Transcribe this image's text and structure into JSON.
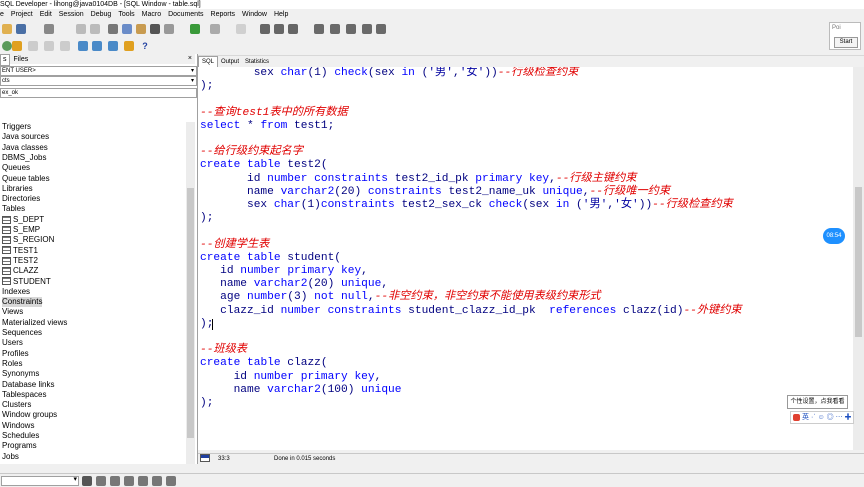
{
  "window": {
    "title": "SQL Developer - lihong@java0104DB - [SQL Window - table.sql]"
  },
  "menu": [
    "e",
    "Project",
    "Edit",
    "Session",
    "Debug",
    "Tools",
    "Macro",
    "Documents",
    "Reports",
    "Window",
    "Help"
  ],
  "floating_widget": {
    "input": "Poi",
    "start_label": "Start"
  },
  "left_panel": {
    "tabs": [
      "s",
      "Files"
    ],
    "user_combo": "ENT USER>",
    "type_combo": "cts",
    "filter_value": "ex_ok",
    "tree_items": [
      {
        "label": "Triggers",
        "icon": "",
        "selected": false
      },
      {
        "label": "Java sources",
        "icon": "",
        "selected": false
      },
      {
        "label": "Java classes",
        "icon": "",
        "selected": false
      },
      {
        "label": "DBMS_Jobs",
        "icon": "",
        "selected": false
      },
      {
        "label": "Queues",
        "icon": "",
        "selected": false
      },
      {
        "label": "Queue tables",
        "icon": "",
        "selected": false
      },
      {
        "label": "Libraries",
        "icon": "",
        "selected": false
      },
      {
        "label": "Directories",
        "icon": "",
        "selected": false
      },
      {
        "label": "Tables",
        "icon": "",
        "selected": false
      },
      {
        "label": "S_DEPT",
        "icon": "table-icon",
        "selected": false
      },
      {
        "label": "S_EMP",
        "icon": "table-icon",
        "selected": false
      },
      {
        "label": "S_REGION",
        "icon": "table-icon",
        "selected": false
      },
      {
        "label": "TEST1",
        "icon": "table-icon",
        "selected": false
      },
      {
        "label": "TEST2",
        "icon": "table-icon",
        "selected": false
      },
      {
        "label": "CLAZZ",
        "icon": "table-icon",
        "selected": false
      },
      {
        "label": "STUDENT",
        "icon": "table-icon",
        "selected": false
      },
      {
        "label": "Indexes",
        "icon": "",
        "selected": false
      },
      {
        "label": "Constraints",
        "icon": "",
        "selected": true
      },
      {
        "label": "Views",
        "icon": "",
        "selected": false
      },
      {
        "label": "Materialized views",
        "icon": "",
        "selected": false
      },
      {
        "label": "Sequences",
        "icon": "",
        "selected": false
      },
      {
        "label": "Users",
        "icon": "",
        "selected": false
      },
      {
        "label": "Profiles",
        "icon": "",
        "selected": false
      },
      {
        "label": "Roles",
        "icon": "",
        "selected": false
      },
      {
        "label": "Synonyms",
        "icon": "",
        "selected": false
      },
      {
        "label": "Database links",
        "icon": "",
        "selected": false
      },
      {
        "label": "Tablespaces",
        "icon": "",
        "selected": false
      },
      {
        "label": "Clusters",
        "icon": "",
        "selected": false
      },
      {
        "label": "Window groups",
        "icon": "",
        "selected": false
      },
      {
        "label": "Windows",
        "icon": "",
        "selected": false
      },
      {
        "label": "Schedules",
        "icon": "",
        "selected": false
      },
      {
        "label": "Programs",
        "icon": "",
        "selected": false
      },
      {
        "label": "Jobs",
        "icon": "",
        "selected": false
      }
    ]
  },
  "editor_tabs": [
    "SQL",
    "Output",
    "Statistics"
  ],
  "code_lines": [
    [
      [
        "pl",
        "        sex "
      ],
      [
        "kw",
        "char"
      ],
      [
        "pl",
        "("
      ],
      [
        "nm",
        "1"
      ],
      [
        "pl",
        ") "
      ],
      [
        "kw",
        "check"
      ],
      [
        "pl",
        "(sex "
      ],
      [
        "kw",
        "in"
      ],
      [
        "pl",
        " ("
      ],
      [
        "str",
        "'男'"
      ],
      [
        "pl",
        ","
      ],
      [
        "str",
        "'女'"
      ],
      [
        "pl",
        "))"
      ],
      [
        "cm",
        "--行级检查约束"
      ]
    ],
    [
      [
        "pl",
        ");"
      ]
    ],
    [
      [
        "pl",
        ""
      ]
    ],
    [
      [
        "cm",
        "--查询test1表中的所有数据"
      ]
    ],
    [
      [
        "kw",
        "select"
      ],
      [
        "pl",
        " * "
      ],
      [
        "kw",
        "from"
      ],
      [
        "pl",
        " test1;"
      ]
    ],
    [
      [
        "pl",
        ""
      ]
    ],
    [
      [
        "cm",
        "--给行级约束起名字"
      ]
    ],
    [
      [
        "kw",
        "create"
      ],
      [
        "pl",
        " "
      ],
      [
        "kw",
        "table"
      ],
      [
        "pl",
        " test2("
      ]
    ],
    [
      [
        "pl",
        "       id "
      ],
      [
        "kw",
        "number"
      ],
      [
        "pl",
        " "
      ],
      [
        "kw",
        "constraints"
      ],
      [
        "pl",
        " test2_id_pk "
      ],
      [
        "kw",
        "primary key"
      ],
      [
        "pl",
        ","
      ],
      [
        "cm",
        "--行级主键约束"
      ]
    ],
    [
      [
        "pl",
        "       name "
      ],
      [
        "kw",
        "varchar2"
      ],
      [
        "pl",
        "("
      ],
      [
        "nm",
        "20"
      ],
      [
        "pl",
        ") "
      ],
      [
        "kw",
        "constraints"
      ],
      [
        "pl",
        " test2_name_uk "
      ],
      [
        "kw",
        "unique"
      ],
      [
        "pl",
        ","
      ],
      [
        "cm",
        "--行级唯一约束"
      ]
    ],
    [
      [
        "pl",
        "       sex "
      ],
      [
        "kw",
        "char"
      ],
      [
        "pl",
        "("
      ],
      [
        "nm",
        "1"
      ],
      [
        "pl",
        ")"
      ],
      [
        "kw",
        "constraints"
      ],
      [
        "pl",
        " test2_sex_ck "
      ],
      [
        "kw",
        "check"
      ],
      [
        "pl",
        "(sex "
      ],
      [
        "kw",
        "in"
      ],
      [
        "pl",
        " ("
      ],
      [
        "str",
        "'男'"
      ],
      [
        "pl",
        ","
      ],
      [
        "str",
        "'女'"
      ],
      [
        "pl",
        "))"
      ],
      [
        "cm",
        "--行级检查约束"
      ]
    ],
    [
      [
        "pl",
        ");"
      ]
    ],
    [
      [
        "pl",
        ""
      ]
    ],
    [
      [
        "cm",
        "--创建学生表"
      ]
    ],
    [
      [
        "kw",
        "create"
      ],
      [
        "pl",
        " "
      ],
      [
        "kw",
        "table"
      ],
      [
        "pl",
        " student("
      ]
    ],
    [
      [
        "pl",
        "   id "
      ],
      [
        "kw",
        "number"
      ],
      [
        "pl",
        " "
      ],
      [
        "kw",
        "primary key"
      ],
      [
        "pl",
        ","
      ]
    ],
    [
      [
        "pl",
        "   name "
      ],
      [
        "kw",
        "varchar2"
      ],
      [
        "pl",
        "("
      ],
      [
        "nm",
        "20"
      ],
      [
        "pl",
        ") "
      ],
      [
        "kw",
        "unique"
      ],
      [
        "pl",
        ","
      ]
    ],
    [
      [
        "pl",
        "   age "
      ],
      [
        "kw",
        "number"
      ],
      [
        "pl",
        "("
      ],
      [
        "nm",
        "3"
      ],
      [
        "pl",
        ") "
      ],
      [
        "kw",
        "not null"
      ],
      [
        "pl",
        ","
      ],
      [
        "cm",
        "--非空约束，非空约束不能使用表级约束形式"
      ]
    ],
    [
      [
        "pl",
        "   clazz_id "
      ],
      [
        "kw",
        "number"
      ],
      [
        "pl",
        " "
      ],
      [
        "kw",
        "constraints"
      ],
      [
        "pl",
        " student_clazz_id_pk  "
      ],
      [
        "kw",
        "references"
      ],
      [
        "pl",
        " clazz(id)"
      ],
      [
        "cm",
        "--外键约束"
      ]
    ],
    [
      [
        "pl",
        ");"
      ]
    ],
    [
      [
        "pl",
        ""
      ]
    ],
    [
      [
        "cm",
        "--班级表"
      ]
    ],
    [
      [
        "kw",
        "create"
      ],
      [
        "pl",
        " "
      ],
      [
        "kw",
        "table"
      ],
      [
        "pl",
        " clazz("
      ]
    ],
    [
      [
        "pl",
        "     id "
      ],
      [
        "kw",
        "number"
      ],
      [
        "pl",
        " "
      ],
      [
        "kw",
        "primary key"
      ],
      [
        "pl",
        ","
      ]
    ],
    [
      [
        "pl",
        "     name "
      ],
      [
        "kw",
        "varchar2"
      ],
      [
        "pl",
        "("
      ],
      [
        "nm",
        "100"
      ],
      [
        "pl",
        ") "
      ],
      [
        "kw",
        "unique"
      ]
    ],
    [
      [
        "pl",
        ");"
      ]
    ]
  ],
  "time_badge": "08:54",
  "tooltip": "个性设置，点我看看",
  "ime_toolbar": "英",
  "status": {
    "position": "33:3",
    "message": "Done in 0.015 seconds"
  },
  "colors": {
    "keyword": "#0000ff",
    "comment": "#e00000",
    "badge": "#1e90ff"
  }
}
